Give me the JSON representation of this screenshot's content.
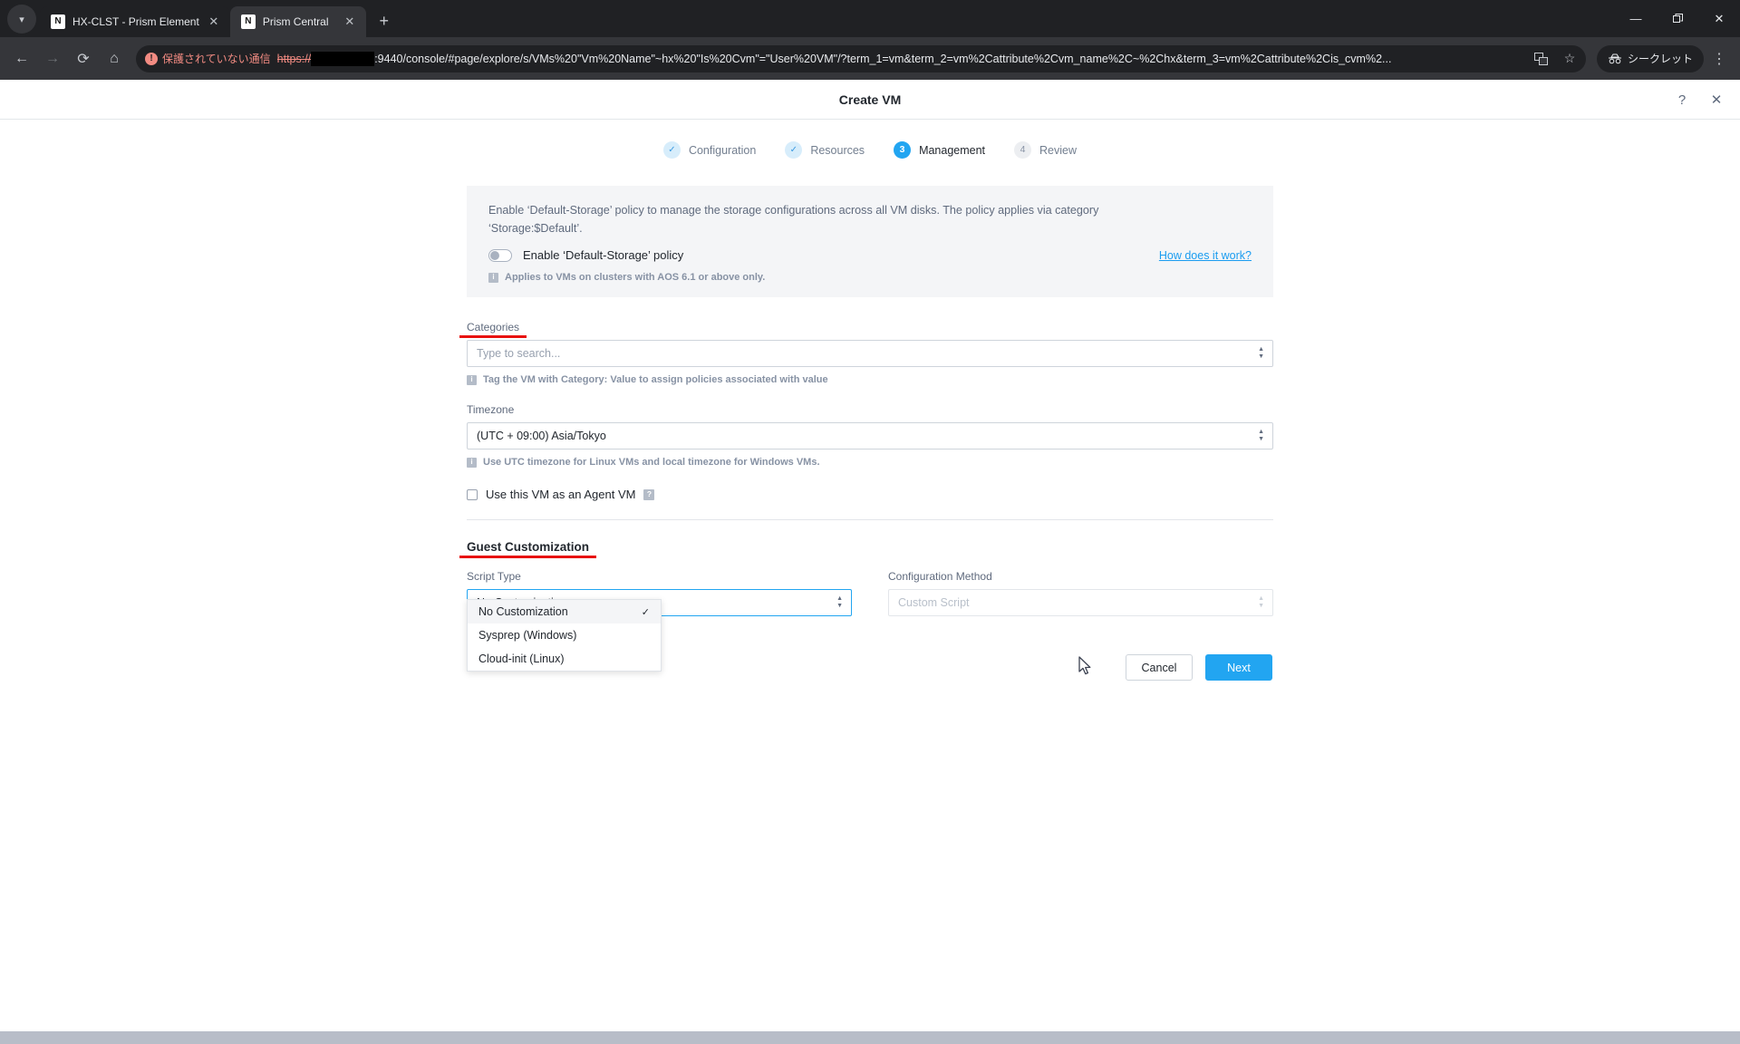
{
  "browser": {
    "tab_list_icon": "chevron-down-icon",
    "tabs": [
      {
        "favicon": "N",
        "title": "HX-CLST - Prism Element",
        "close": "✕",
        "active": false
      },
      {
        "favicon": "N",
        "title": "Prism Central",
        "close": "✕",
        "active": true
      }
    ],
    "new_tab": "+",
    "window_controls": {
      "minimize": "—",
      "restore": "❐",
      "close": "✕"
    },
    "nav": {
      "back": "←",
      "forward": "→",
      "reload": "⟳",
      "home": "⌂"
    },
    "omnibox": {
      "security_label": "保護されていない通信",
      "security_icon": "not-secure-icon",
      "url_scheme": "https://",
      "url_rest": ":9440/console/#page/explore/s/VMs%20\"Vm%20Name\"~hx%20\"Is%20Cvm\"=\"User%20VM\"/?term_1=vm&term_2=vm%2Cattribute%2Cvm_name%2C~%2Chx&term_3=vm%2Cattribute%2Cis_cvm%2...",
      "translate_icon": "translate-icon",
      "bookmark_icon": "star-icon"
    },
    "incognito_label": "シークレット",
    "incognito_icon": "incognito-icon",
    "menu_icon": "kebab-menu-icon"
  },
  "modal": {
    "title": "Create VM",
    "help_icon": "?",
    "close_icon": "✕"
  },
  "steps": [
    {
      "bubble": "✓",
      "label": "Configuration",
      "state": "done"
    },
    {
      "bubble": "✓",
      "label": "Resources",
      "state": "done"
    },
    {
      "bubble": "3",
      "label": "Management",
      "state": "current"
    },
    {
      "bubble": "4",
      "label": "Review",
      "state": "todo"
    }
  ],
  "policy": {
    "description": "Enable ‘Default-Storage’ policy to manage the storage configurations across all VM disks. The policy applies via category ‘Storage:$Default’.",
    "toggle_label": "Enable ‘Default-Storage’ policy",
    "toggle_state": "off",
    "link_label": "How does it work?",
    "note_icon": "i",
    "note": "Applies to VMs on clusters with AOS 6.1 or above only."
  },
  "categories": {
    "label": "Categories",
    "placeholder": "Type to search...",
    "value": "",
    "hint_icon": "i",
    "hint": "Tag the VM with Category: Value to assign policies associated with value"
  },
  "timezone": {
    "label": "Timezone",
    "value": "(UTC + 09:00) Asia/Tokyo",
    "hint_icon": "i",
    "hint": "Use UTC timezone for Linux VMs and local timezone for Windows VMs."
  },
  "agent_vm": {
    "label": "Use this VM as an Agent VM",
    "checked": false,
    "help_icon": "?"
  },
  "guest_customization": {
    "section_title": "Guest Customization",
    "script_type": {
      "label": "Script Type",
      "value": "No Customization",
      "focused": true,
      "options": [
        {
          "label": "No Customization",
          "selected": true
        },
        {
          "label": "Sysprep (Windows)",
          "selected": false
        },
        {
          "label": "Cloud-init (Linux)",
          "selected": false
        }
      ],
      "check_glyph": "✓"
    },
    "configuration_method": {
      "label": "Configuration Method",
      "value": "Custom Script",
      "disabled": true
    }
  },
  "footer": {
    "cancel_label": "Cancel",
    "next_label": "Next"
  },
  "annotations": {
    "underline_color": "#e8110d"
  }
}
